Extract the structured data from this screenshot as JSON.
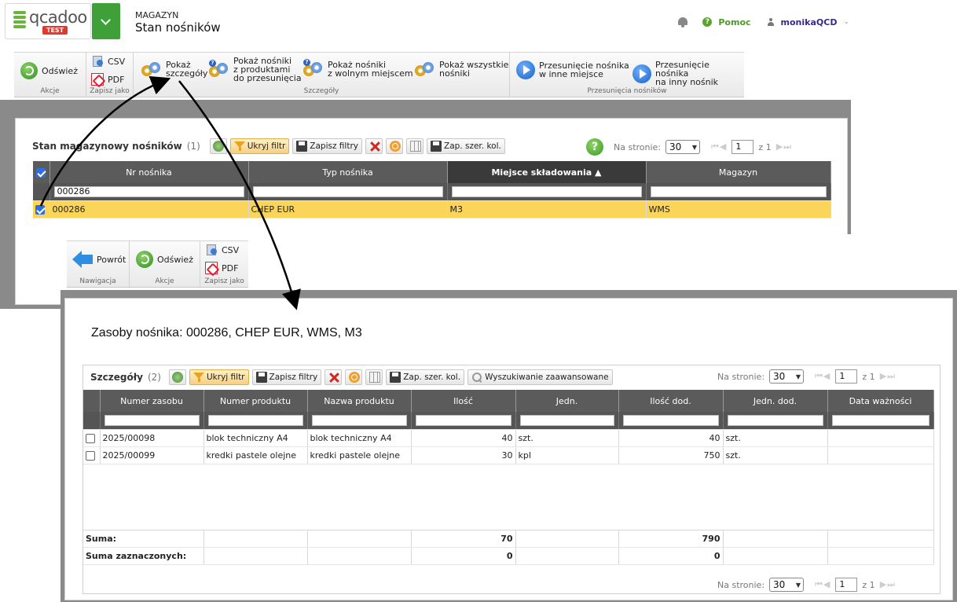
{
  "header": {
    "logo_text": "qcadoo",
    "logo_badge": "TEST",
    "section": "MAGAZYN",
    "title": "Stan nośników",
    "help_label": "Pomoc",
    "user": "monikaQCD"
  },
  "ribbon_main": {
    "refresh": "Odśwież",
    "csv": "CSV",
    "pdf": "PDF",
    "show_details_l1": "Pokaż",
    "show_details_l2": "szczegóły",
    "show_with_products_l1": "Pokaż nośniki",
    "show_with_products_l2": "z produktami",
    "show_with_products_l3": "do przesunięcia",
    "show_free_l1": "Pokaż nośniki",
    "show_free_l2": "z wolnym miejscem",
    "show_all_l1": "Pokaż wszystkie",
    "show_all_l2": "nośniki",
    "move_place_l1": "Przesunięcie nośnika",
    "move_place_l2": "w inne miejsce",
    "move_carrier_l1": "Przesunięcie nośnika",
    "move_carrier_l2": "na inny nośnik",
    "group_actions": "Akcje",
    "group_save_as": "Zapisz jako",
    "group_details": "Szczegóły",
    "group_moves": "Przesunięcia nośników"
  },
  "grid_main": {
    "title": "Stan magazynowy nośników",
    "count": "(1)",
    "hide_filter": "Ukryj filtr",
    "save_filters": "Zapisz filtry",
    "save_col_width": "Zap. szer. kol.",
    "per_page_label": "Na stronie:",
    "per_page": "30",
    "page": "1",
    "of_pages": "z 1",
    "columns": [
      "Nr nośnika",
      "Typ nośnika",
      "Miejsce składowania",
      "Magazyn"
    ],
    "filters": [
      "000286",
      "",
      "",
      ""
    ],
    "rows": [
      {
        "nr": "000286",
        "typ": "CHEP EUR",
        "miejsce": "M3",
        "magazyn": "WMS"
      }
    ]
  },
  "ribbon_detail": {
    "back": "Powrót",
    "refresh": "Odśwież",
    "csv": "CSV",
    "pdf": "PDF",
    "group_nav": "Nawigacja",
    "group_actions": "Akcje",
    "group_save_as": "Zapisz jako"
  },
  "detail": {
    "title": "Zasoby nośnika: 000286, CHEP EUR, WMS, M3",
    "grid_title": "Szczegóły",
    "count": "(2)",
    "hide_filter": "Ukryj filtr",
    "save_filters": "Zapisz filtry",
    "save_col_width": "Zap. szer. kol.",
    "advanced_search": "Wyszukiwanie zaawansowane",
    "per_page_label": "Na stronie:",
    "per_page": "30",
    "page": "1",
    "of_pages": "z 1",
    "columns": [
      "Numer zasobu",
      "Numer produktu",
      "Nazwa produktu",
      "Ilość",
      "Jedn.",
      "Ilość dod.",
      "Jedn. dod.",
      "Data ważności"
    ],
    "rows": [
      {
        "zasob": "2025/00098",
        "nr_prod": "blok techniczny A4",
        "nazwa": "blok techniczny A4",
        "ilosc": "40",
        "jedn": "szt.",
        "ilosc_dod": "40",
        "jedn_dod": "szt.",
        "data": ""
      },
      {
        "zasob": "2025/00099",
        "nr_prod": "kredki pastele olejne",
        "nazwa": "kredki pastele olejne",
        "ilosc": "30",
        "jedn": "kpl",
        "ilosc_dod": "750",
        "jedn_dod": "szt.",
        "data": ""
      }
    ],
    "sum_label": "Suma:",
    "sum_ilosc": "70",
    "sum_ilosc_dod": "790",
    "sum_selected_label": "Suma zaznaczonych:",
    "sum_selected_ilosc": "0",
    "sum_selected_ilosc_dod": "0"
  }
}
